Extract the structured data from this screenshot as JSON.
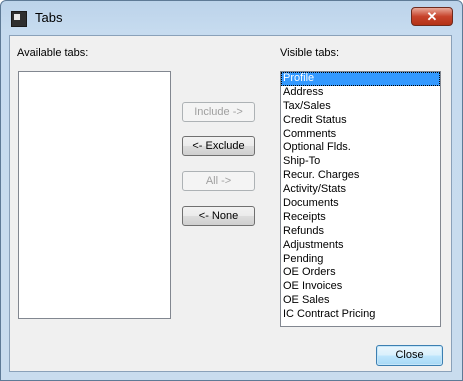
{
  "window": {
    "title": "Tabs",
    "close_glyph": "✕",
    "icon": "app-icon",
    "accent_color": "#3399ff"
  },
  "available": {
    "label": "Available tabs:",
    "items": []
  },
  "visible": {
    "label": "Visible tabs:",
    "selected_index": 0,
    "items": [
      "Profile",
      "Address",
      "Tax/Sales",
      "Credit Status",
      "Comments",
      "Optional Flds.",
      "Ship-To",
      "Recur. Charges",
      "Activity/Stats",
      "Documents",
      "Receipts",
      "Refunds",
      "Adjustments",
      "Pending",
      "OE Orders",
      "OE Invoices",
      "OE Sales",
      "IC Contract Pricing"
    ]
  },
  "buttons": {
    "include": "Include ->",
    "exclude": "<- Exclude",
    "all": "All ->",
    "none": "<- None",
    "close": "Close"
  }
}
